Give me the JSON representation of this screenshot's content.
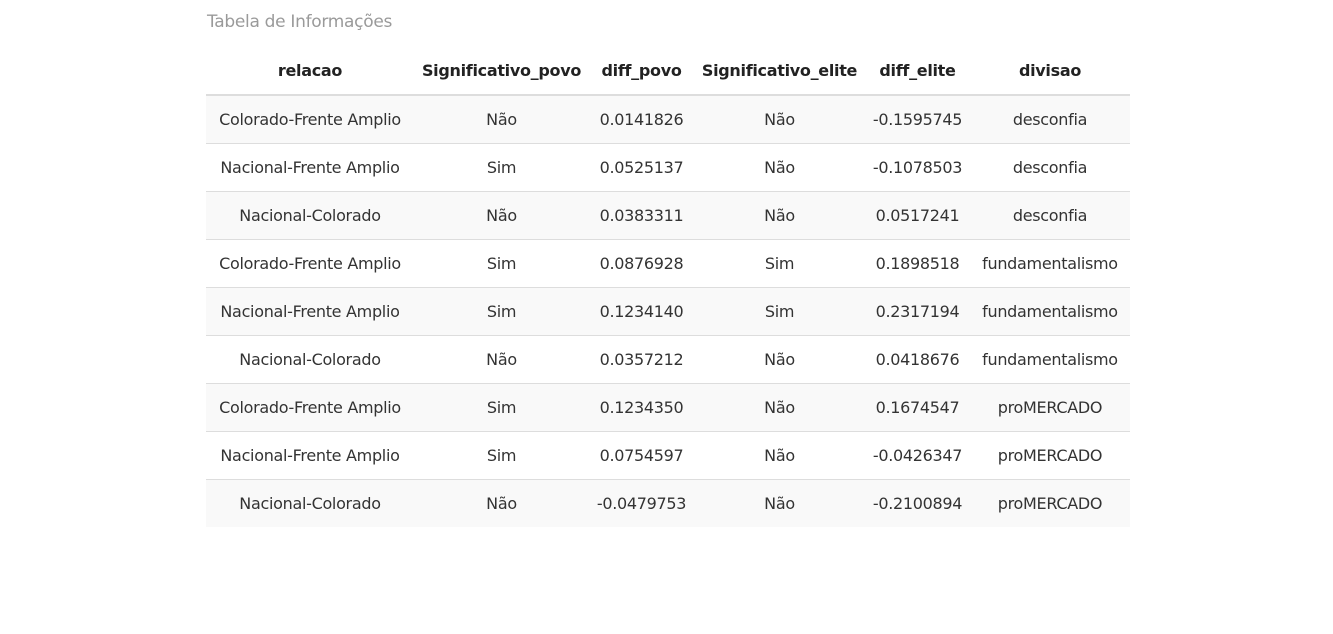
{
  "caption": "Tabela de Informações",
  "table": {
    "columns": [
      "relacao",
      "Significativo_povo",
      "diff_povo",
      "Significativo_elite",
      "diff_elite",
      "divisao"
    ],
    "rows": [
      [
        "Colorado-Frente Amplio",
        "Não",
        "0.0141826",
        "Não",
        "-0.1595745",
        "desconfia"
      ],
      [
        "Nacional-Frente Amplio",
        "Sim",
        "0.0525137",
        "Não",
        "-0.1078503",
        "desconfia"
      ],
      [
        "Nacional-Colorado",
        "Não",
        "0.0383311",
        "Não",
        "0.0517241",
        "desconfia"
      ],
      [
        "Colorado-Frente Amplio",
        "Sim",
        "0.0876928",
        "Sim",
        "0.1898518",
        "fundamentalismo"
      ],
      [
        "Nacional-Frente Amplio",
        "Sim",
        "0.1234140",
        "Sim",
        "0.2317194",
        "fundamentalismo"
      ],
      [
        "Nacional-Colorado",
        "Não",
        "0.0357212",
        "Não",
        "0.0418676",
        "fundamentalismo"
      ],
      [
        "Colorado-Frente Amplio",
        "Sim",
        "0.1234350",
        "Não",
        "0.1674547",
        "proMERCADO"
      ],
      [
        "Nacional-Frente Amplio",
        "Sim",
        "0.0754597",
        "Não",
        "-0.0426347",
        "proMERCADO"
      ],
      [
        "Nacional-Colorado",
        "Não",
        "-0.0479753",
        "Não",
        "-0.2100894",
        "proMERCADO"
      ]
    ]
  }
}
